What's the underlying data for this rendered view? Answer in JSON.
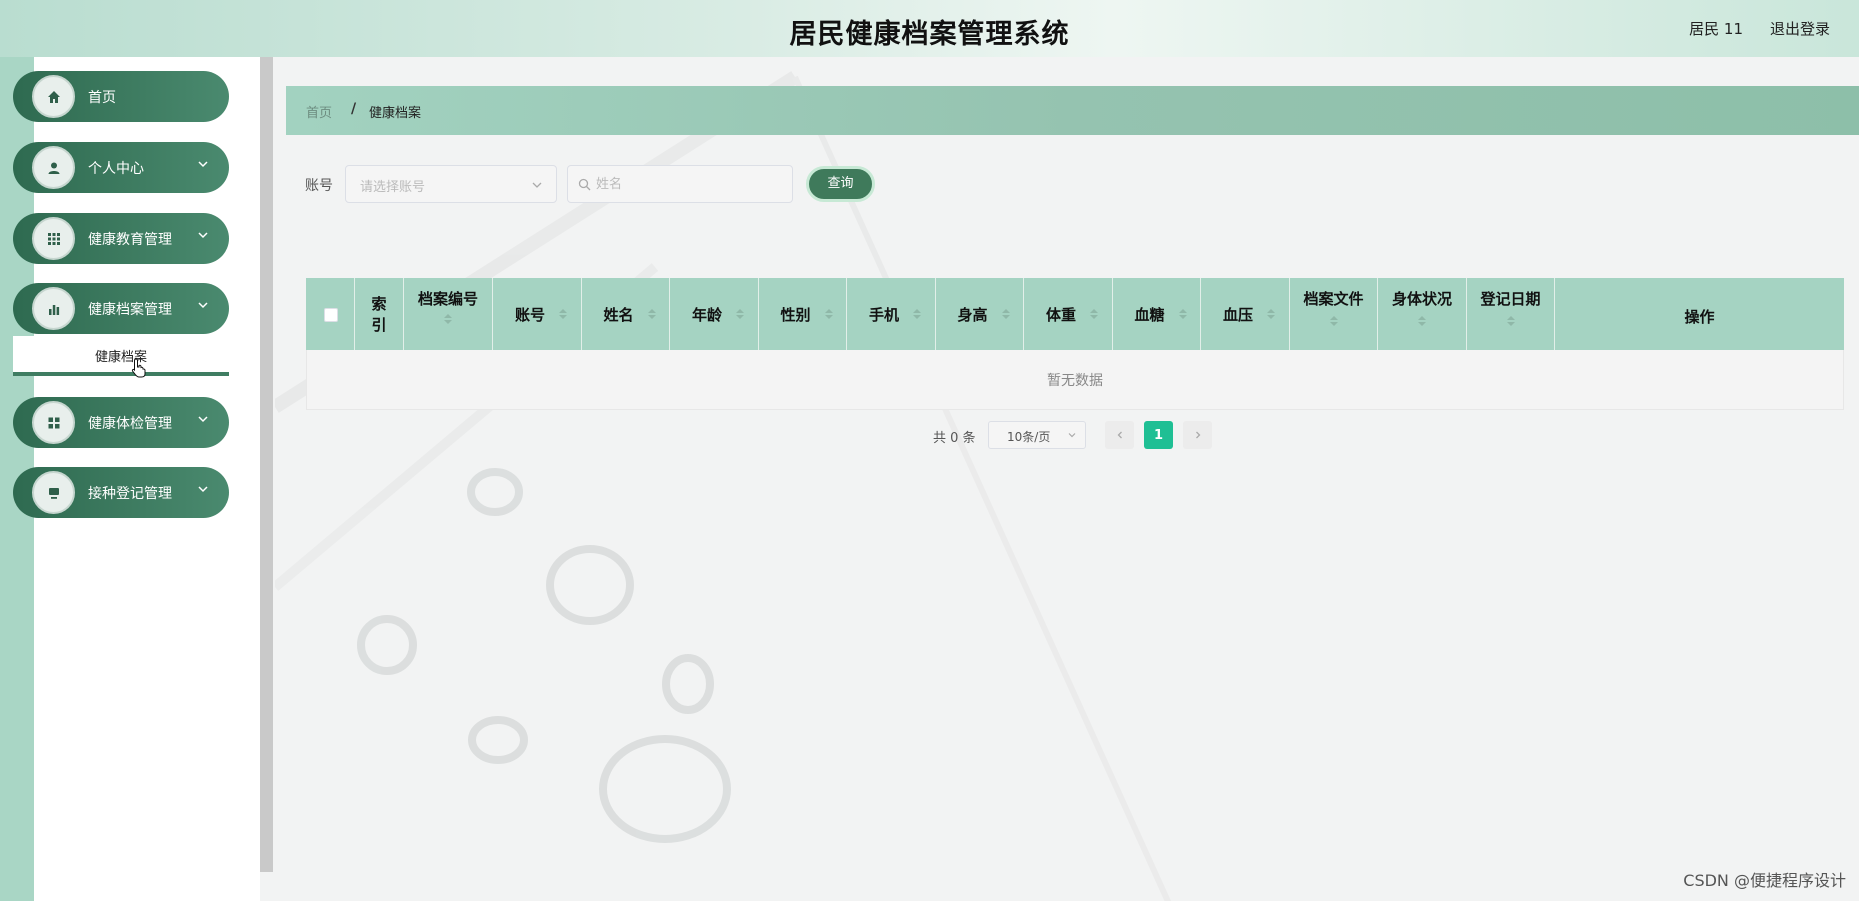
{
  "header": {
    "title": "居民健康档案管理系统",
    "user": "居民 11",
    "logout": "退出登录"
  },
  "sidebar": {
    "items": [
      {
        "label": "首页",
        "icon": "home-icon"
      },
      {
        "label": "个人中心",
        "icon": "user-icon"
      },
      {
        "label": "健康教育管理",
        "icon": "grid-icon"
      },
      {
        "label": "健康档案管理",
        "icon": "bar-chart-icon"
      },
      {
        "label": "健康体检管理",
        "icon": "apps-icon"
      },
      {
        "label": "接种登记管理",
        "icon": "monitor-icon"
      }
    ],
    "submenu": {
      "label": "健康档案"
    }
  },
  "breadcrumb": {
    "home": "首页",
    "separator": "/",
    "current": "健康档案"
  },
  "filters": {
    "account_label": "账号",
    "account_placeholder": "请选择账号",
    "name_placeholder": "姓名",
    "query_label": "查询"
  },
  "table": {
    "columns": [
      "索引",
      "档案编号",
      "账号",
      "姓名",
      "年龄",
      "性别",
      "手机",
      "身高",
      "体重",
      "血糖",
      "血压",
      "档案文件",
      "身体状况",
      "登记日期",
      "操作"
    ],
    "empty_text": "暂无数据"
  },
  "pagination": {
    "total_text": "共 0 条",
    "page_size": "10条/页",
    "current_page": "1"
  },
  "footer": {
    "watermark": "CSDN @便捷程序设计"
  },
  "colors": {
    "primary": "#3f7d62",
    "header_bg": "#a5d3c2",
    "active_page": "#1fbf94"
  }
}
